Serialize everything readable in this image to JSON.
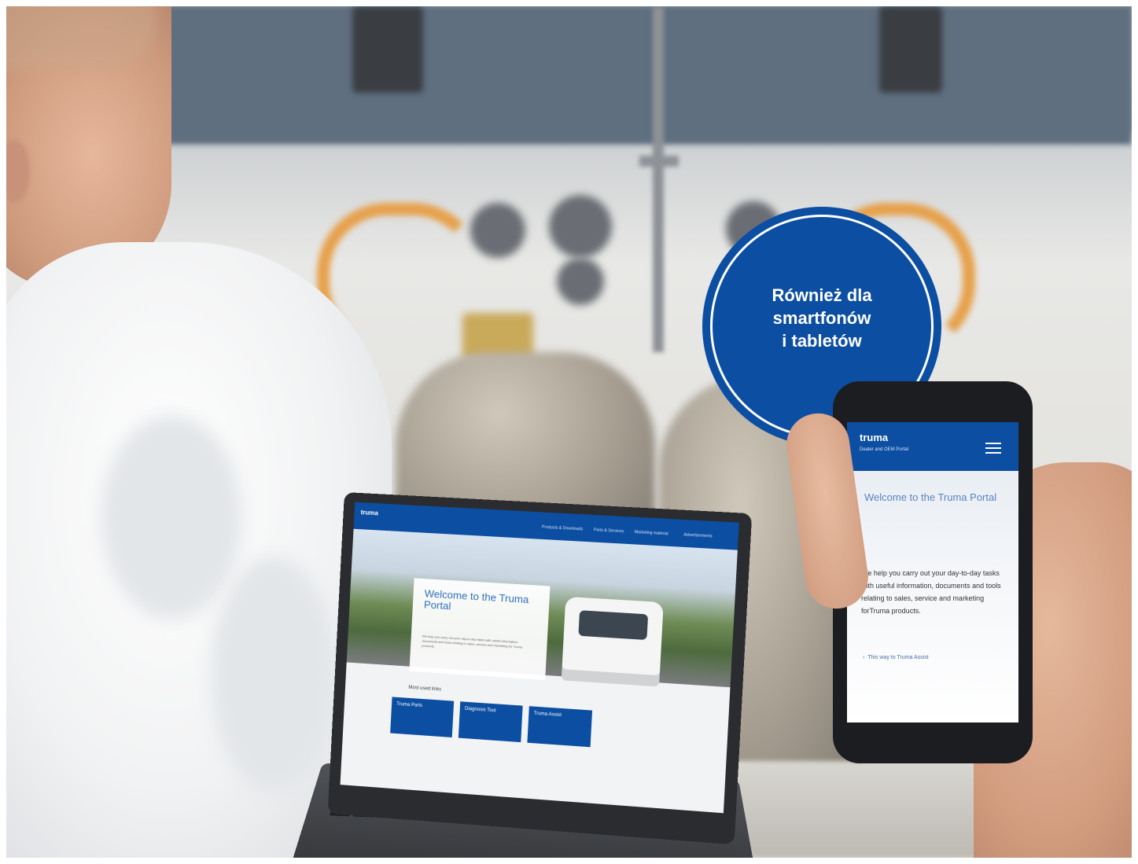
{
  "badge": {
    "line1": "Również dla",
    "line2": "smartfonów",
    "line3": "i tabletów",
    "color": "#0c4ea2"
  },
  "laptop_screen": {
    "logo": "truma",
    "nav": [
      "Products & Downloads",
      "Parts & Services",
      "Marketing material",
      "Advertisements"
    ],
    "hero_title": "Welcome to the Truma Portal",
    "hero_body": "We help you carry out your day-to-day tasks with useful information, documents and tools relating to sales, service and marketing for Truma products.",
    "sub_heading": "Most used links",
    "tiles": [
      "Truma Parts",
      "Diagnosis Tool",
      "Truma Assist"
    ]
  },
  "phone_screen": {
    "logo": "truma",
    "portal_name": "Dealer and OEM Portal",
    "title": "Welcome to the Truma Portal",
    "body": "We help you carry out your day-to-day tasks with useful information, documents and tools relating to sales, service and marketing forTruma products.",
    "link": "This way to Truma Assist"
  }
}
